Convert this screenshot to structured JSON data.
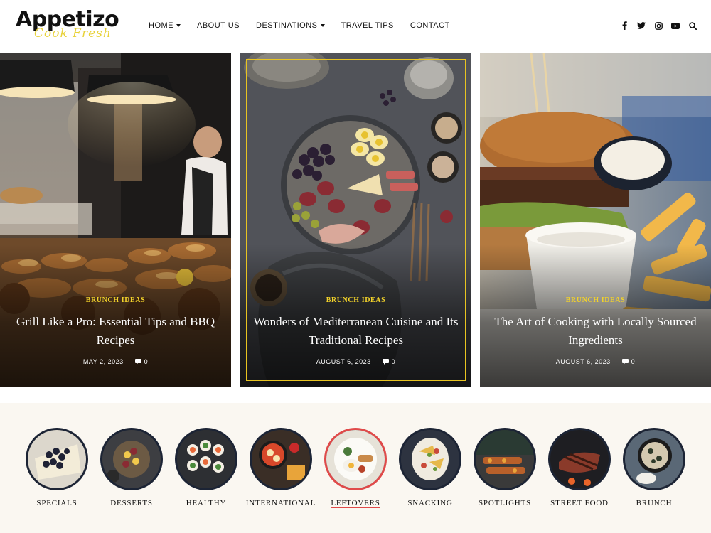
{
  "brand": {
    "name": "Appetizo",
    "tagline": "Cook Fresh"
  },
  "nav": {
    "items": [
      {
        "label": "HOME",
        "dropdown": true
      },
      {
        "label": "ABOUT US",
        "dropdown": false
      },
      {
        "label": "DESTINATIONS",
        "dropdown": true
      },
      {
        "label": "TRAVEL TIPS",
        "dropdown": false
      },
      {
        "label": "CONTACT",
        "dropdown": false
      }
    ]
  },
  "social": [
    "facebook-icon",
    "twitter-icon",
    "instagram-icon",
    "youtube-icon",
    "search-icon"
  ],
  "hero": [
    {
      "category": "BRUNCH IDEAS",
      "title": "Grill Like a Pro: Essential Tips and BBQ Recipes",
      "date": "MAY 2, 2023",
      "comments": "0"
    },
    {
      "category": "BRUNCH IDEAS",
      "title": "Wonders of Mediterranean Cuisine and Its Traditional Recipes",
      "date": "AUGUST 6, 2023",
      "comments": "0"
    },
    {
      "category": "BRUNCH IDEAS",
      "title": "The Art of Cooking with Locally Sourced Ingredients",
      "date": "AUGUST 6, 2023",
      "comments": "0"
    }
  ],
  "categories": [
    {
      "label": "SPECIALS"
    },
    {
      "label": "DESSERTS"
    },
    {
      "label": "HEALTHY"
    },
    {
      "label": "INTERNATIONAL"
    },
    {
      "label": "LEFTOVERS",
      "active": true
    },
    {
      "label": "SNACKING"
    },
    {
      "label": "SPOTLIGHTS"
    },
    {
      "label": "STREET FOOD"
    },
    {
      "label": "BRUNCH"
    }
  ],
  "colors": {
    "accent": "#f2d22a",
    "active_ring": "#e04a4a",
    "ring": "#1c2435",
    "strip_bg": "#faf7f1"
  }
}
